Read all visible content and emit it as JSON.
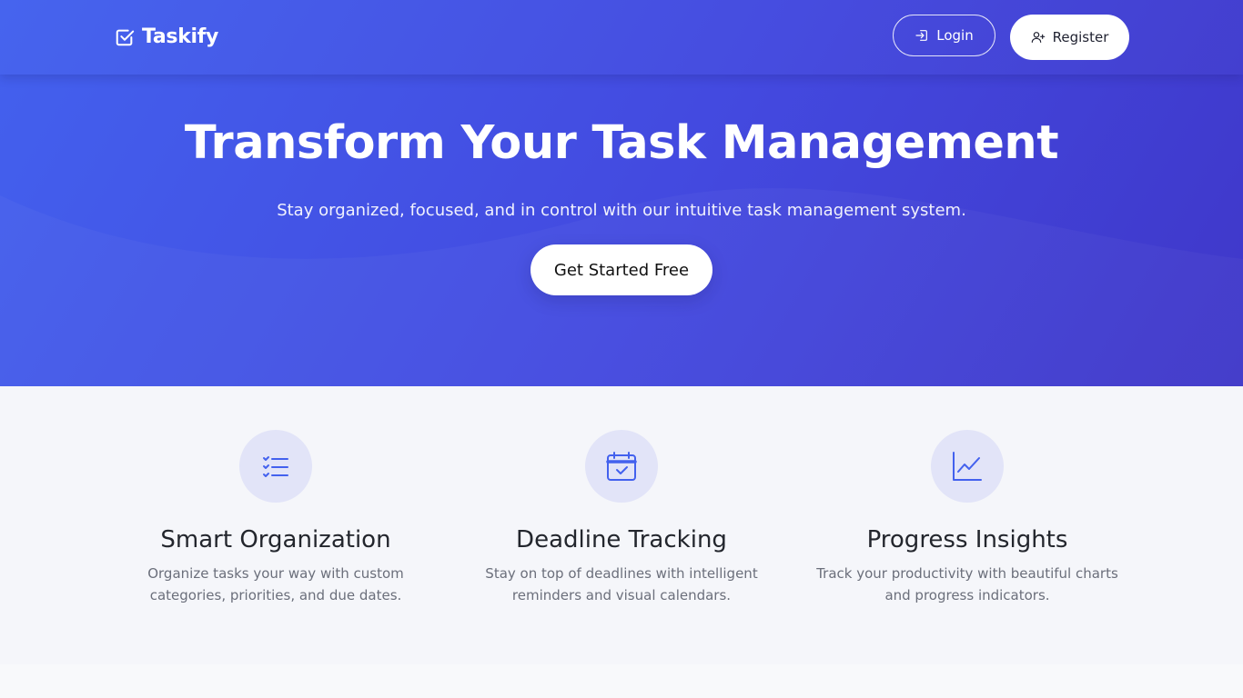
{
  "brand": {
    "name": "Taskify",
    "icon": "check-square-icon"
  },
  "nav": {
    "login_label": "Login",
    "login_icon": "sign-in-icon",
    "register_label": "Register",
    "register_icon": "user-plus-icon"
  },
  "hero": {
    "title": "Transform Your Task Management",
    "subtitle": "Stay organized, focused, and in control with our intuitive task management system.",
    "cta_label": "Get Started Free"
  },
  "features": [
    {
      "icon": "list-check-icon",
      "title": "Smart Organization",
      "description": "Organize tasks your way with custom categories, priorities, and due dates."
    },
    {
      "icon": "calendar-check-icon",
      "title": "Deadline Tracking",
      "description": "Stay on top of deadlines with intelligent reminders and visual calendars."
    },
    {
      "icon": "chart-line-icon",
      "title": "Progress Insights",
      "description": "Track your productivity with beautiful charts and progress indicators."
    }
  ],
  "colors": {
    "primary": "#4361ee",
    "primary_dark": "#3f37c9",
    "icon_circle": "#e2e4f8",
    "icon_stroke": "#4361ee",
    "section_bg": "#f5f6fa"
  }
}
